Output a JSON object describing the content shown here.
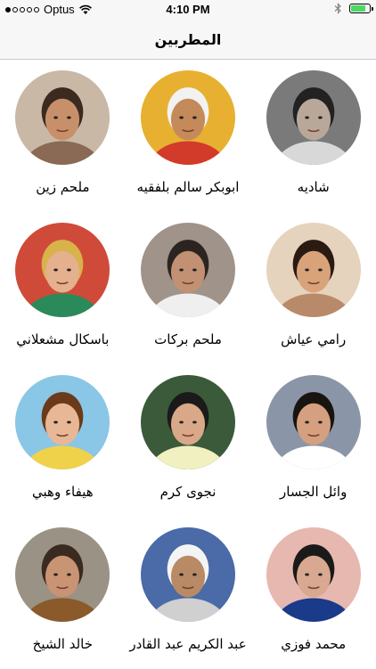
{
  "status": {
    "carrier": "Optus",
    "time": "4:10 PM",
    "battery_color": "#4cd964",
    "battery_level": 0.8
  },
  "nav": {
    "title": "المطربين"
  },
  "singers": [
    {
      "name": "شاديه",
      "bg": "#7a7a7a",
      "skin": "#b9a89a",
      "hair": "#222222",
      "accent": "#d8d8d8"
    },
    {
      "name": "ابوبكر سالم بلفقيه",
      "bg": "#e8b030",
      "skin": "#c48a5a",
      "hair": "#f2f2f2",
      "accent": "#d23a2a"
    },
    {
      "name": "ملحم زين",
      "bg": "#c9b8a6",
      "skin": "#c8906a",
      "hair": "#3a2a20",
      "accent": "#8a6a55"
    },
    {
      "name": "رامي عياش",
      "bg": "#e6d3bd",
      "skin": "#d9a37a",
      "hair": "#2a1a12",
      "accent": "#b98a6a"
    },
    {
      "name": "ملحم بركات",
      "bg": "#a0938a",
      "skin": "#c29072",
      "hair": "#2c2420",
      "accent": "#efefef"
    },
    {
      "name": "باسكال مشعلاني",
      "bg": "#d04a3a",
      "skin": "#e4b08e",
      "hair": "#d8b24a",
      "accent": "#2a8a5a"
    },
    {
      "name": "وائل الجسار",
      "bg": "#8a96a8",
      "skin": "#d4a080",
      "hair": "#1a1410",
      "accent": "#ffffff"
    },
    {
      "name": "نجوى كرم",
      "bg": "#3a5a3a",
      "skin": "#d8a888",
      "hair": "#1a1a1a",
      "accent": "#f0f0c0"
    },
    {
      "name": "هيفاء وهبي",
      "bg": "#8ac6e6",
      "skin": "#e8b896",
      "hair": "#6a3a1a",
      "accent": "#f0d24a"
    },
    {
      "name": "محمد فوزي",
      "bg": "#e6b8b0",
      "skin": "#d8a890",
      "hair": "#1a1a1a",
      "accent": "#1a3a8a"
    },
    {
      "name": "عبد الكريم عبد القادر",
      "bg": "#4a6aa8",
      "skin": "#b88a66",
      "hair": "#f4f4f4",
      "accent": "#d0d0d0"
    },
    {
      "name": "خالد الشيخ",
      "bg": "#9a9284",
      "skin": "#c89474",
      "hair": "#3a2a20",
      "accent": "#8a5a2a"
    }
  ]
}
